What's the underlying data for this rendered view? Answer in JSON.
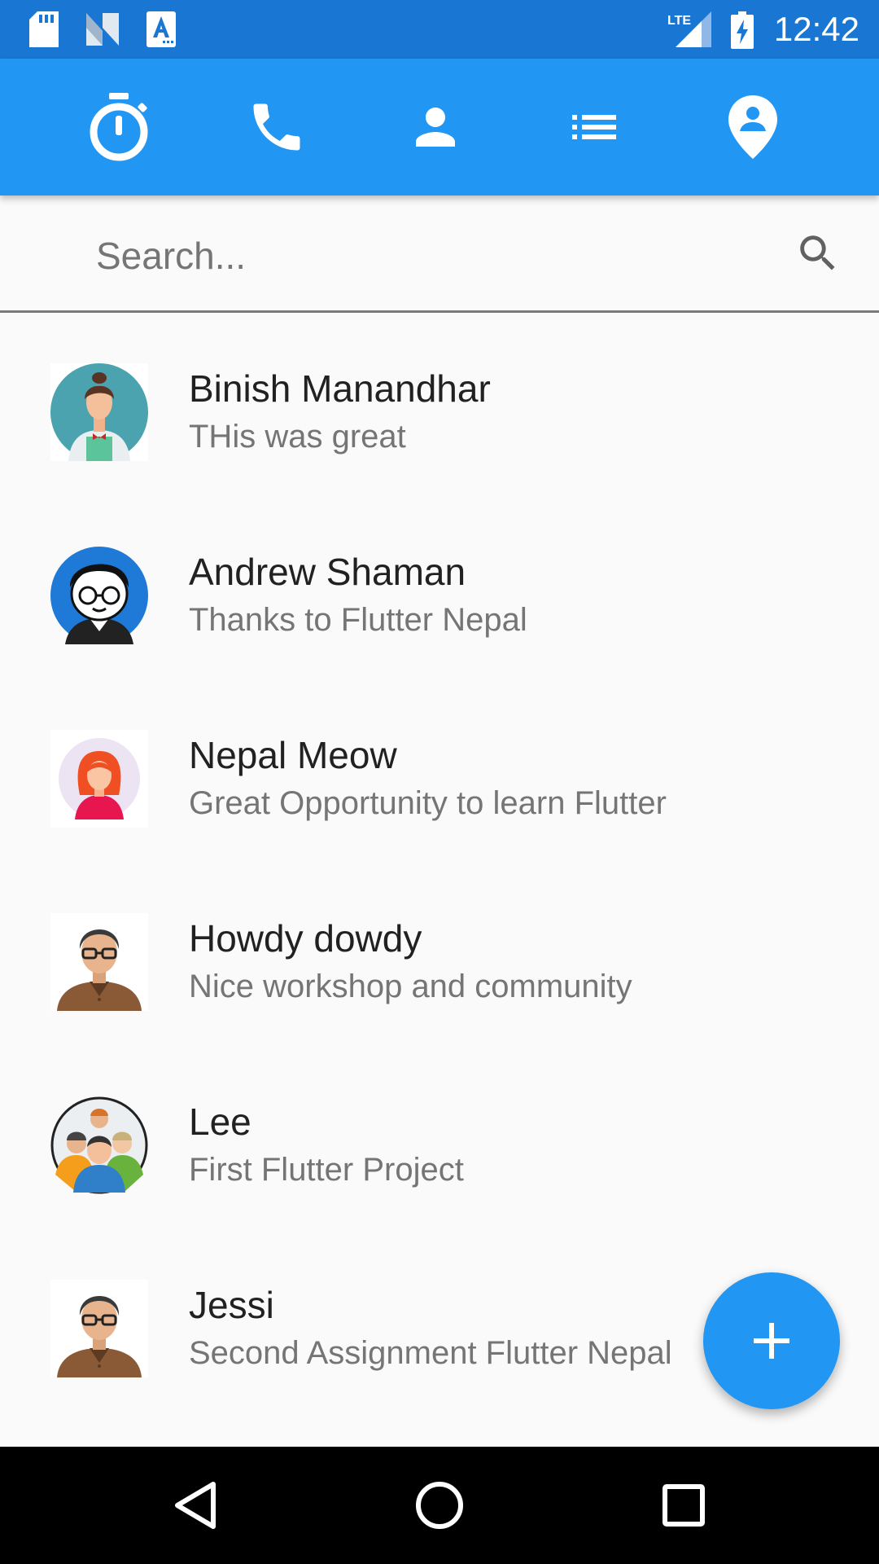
{
  "status_bar": {
    "time": "12:42",
    "network": "LTE",
    "icons": [
      "sd-card-icon",
      "n-logo-icon",
      "font-a-icon",
      "lte-signal-icon",
      "battery-charging-icon"
    ]
  },
  "tabs": [
    {
      "icon": "timer-icon"
    },
    {
      "icon": "phone-icon"
    },
    {
      "icon": "person-icon"
    },
    {
      "icon": "list-icon"
    },
    {
      "icon": "location-person-icon"
    }
  ],
  "search": {
    "placeholder": "Search...",
    "value": ""
  },
  "contacts": [
    {
      "name": "Binish Manandhar",
      "message": "THis was great"
    },
    {
      "name": "Andrew Shaman",
      "message": "Thanks to Flutter Nepal"
    },
    {
      "name": "Nepal Meow",
      "message": "Great Opportunity to learn Flutter"
    },
    {
      "name": "Howdy dowdy",
      "message": "Nice workshop and community"
    },
    {
      "name": "Lee",
      "message": "First Flutter Project"
    },
    {
      "name": "Jessi",
      "message": "Second Assignment Flutter Nepal"
    }
  ],
  "fab": {
    "icon": "add-icon"
  },
  "colors": {
    "primary": "#2196f3",
    "primary_dark": "#1976d2",
    "background": "#fafafa"
  }
}
